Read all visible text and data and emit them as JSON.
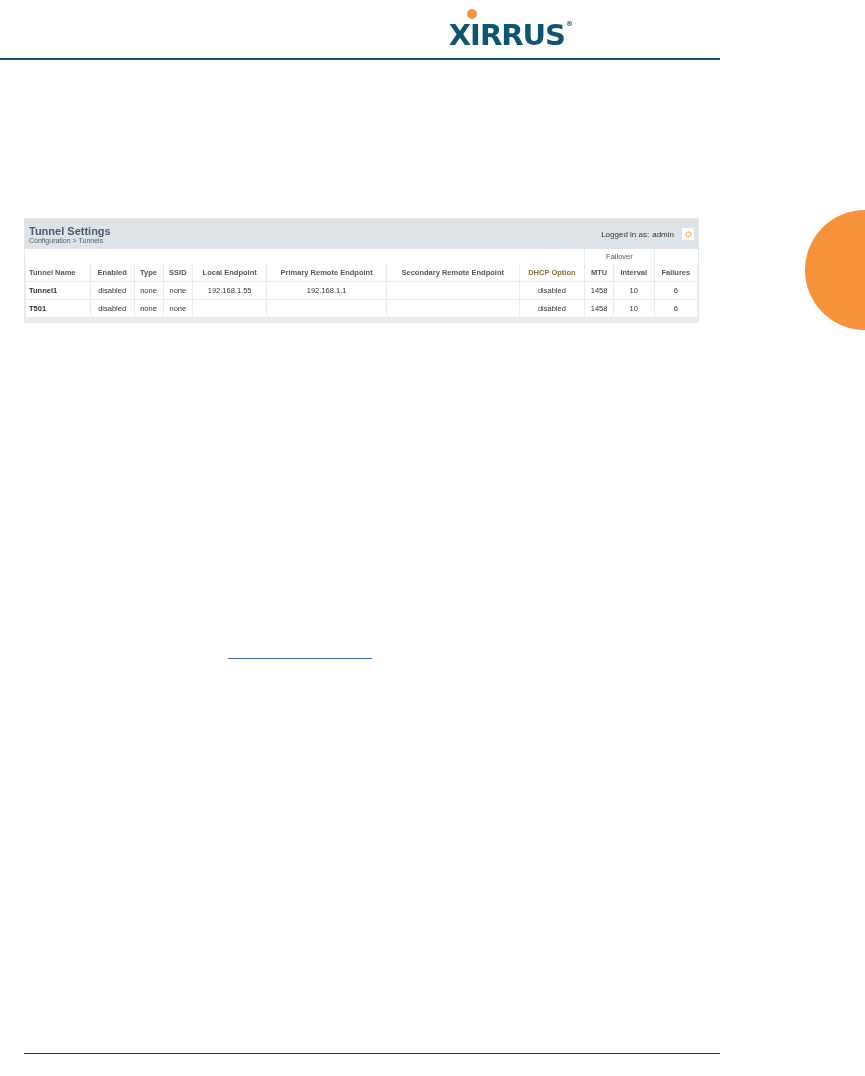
{
  "logo": {
    "text": "XIRRUS",
    "mark": "®"
  },
  "panel": {
    "title": "Tunnel Settings",
    "breadcrumb": "Configuration > Tunnels",
    "login_label": "Logged in as:",
    "user": "admin"
  },
  "table": {
    "group_header": "Failover",
    "columns": [
      {
        "label": "Tunnel Name",
        "highlighted": false
      },
      {
        "label": "Enabled",
        "highlighted": false
      },
      {
        "label": "Type",
        "highlighted": false
      },
      {
        "label": "SSID",
        "highlighted": false
      },
      {
        "label": "Local Endpoint",
        "highlighted": false
      },
      {
        "label": "Primary Remote Endpoint",
        "highlighted": false
      },
      {
        "label": "Secondary Remote Endpoint",
        "highlighted": false
      },
      {
        "label": "DHCP Option",
        "highlighted": true
      },
      {
        "label": "MTU",
        "highlighted": false
      },
      {
        "label": "Interval",
        "highlighted": false
      },
      {
        "label": "Failures",
        "highlighted": false
      }
    ],
    "rows": [
      [
        "Tunnel1",
        "disabled",
        "none",
        "none",
        "192.168.1.55",
        "192.168.1.1",
        "",
        "disabled",
        "1458",
        "10",
        "6"
      ],
      [
        "T501",
        "disabled",
        "none",
        "none",
        "",
        "",
        "",
        "disabled",
        "1458",
        "10",
        "6"
      ]
    ]
  }
}
